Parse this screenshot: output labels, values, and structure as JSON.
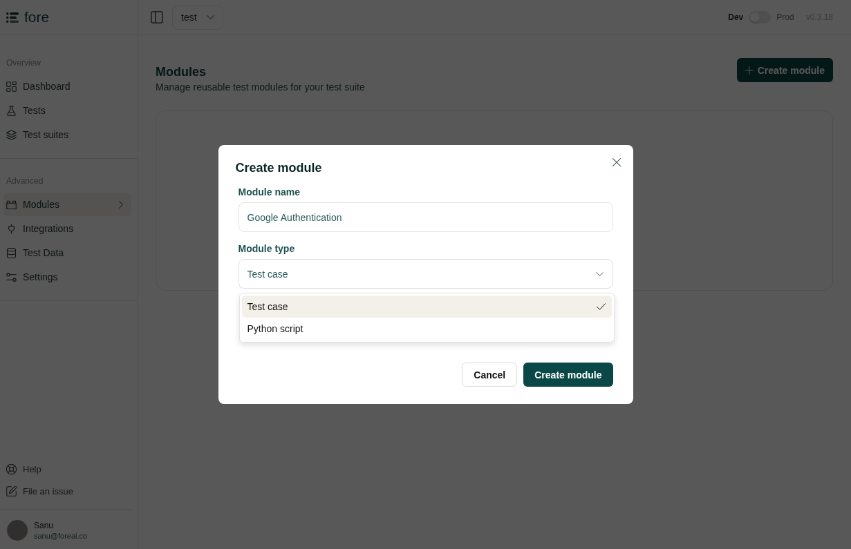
{
  "sidebar": {
    "logo": "fore",
    "sections": [
      {
        "heading": "Overview",
        "items": [
          {
            "label": "Dashboard",
            "selected": false
          },
          {
            "label": "Tests",
            "selected": false
          },
          {
            "label": "Test suites",
            "selected": false
          }
        ]
      },
      {
        "heading": "Advanced",
        "items": [
          {
            "label": "Modules",
            "selected": true
          },
          {
            "label": "Integrations",
            "selected": false
          },
          {
            "label": "Test Data",
            "selected": false
          },
          {
            "label": "Settings",
            "selected": false
          }
        ]
      }
    ],
    "footer_links": [
      {
        "label": "Help"
      },
      {
        "label": "File an issue"
      }
    ],
    "user": {
      "name": "Sanu",
      "email": "sanu@foreai.co"
    }
  },
  "topbar": {
    "project_select": {
      "value": "test"
    },
    "environment": {
      "left_label": "Dev",
      "right_label": "Prod",
      "on": false
    },
    "version": "v0.3.18"
  },
  "page": {
    "title": "Modules",
    "subtitle": "Manage reusable test modules for your test suite",
    "create_button": "Create module"
  },
  "dialog": {
    "title": "Create module",
    "fields": [
      {
        "kind": "text",
        "label": "Module name",
        "value": "Google Authentication"
      },
      {
        "kind": "select",
        "label": "Module type",
        "value": "Test case",
        "expanded": true,
        "options": [
          {
            "label": "Test case",
            "selected": true
          },
          {
            "label": "Python script",
            "selected": false
          }
        ]
      }
    ],
    "buttons": [
      {
        "kind": "secondary",
        "label": "Cancel"
      },
      {
        "kind": "primary",
        "label": "Create module"
      }
    ]
  }
}
